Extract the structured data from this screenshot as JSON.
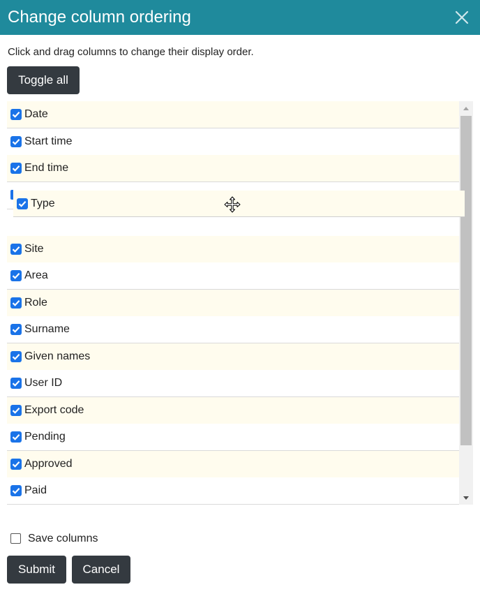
{
  "dialog": {
    "title": "Change column ordering",
    "close_icon": "close-icon",
    "instruction": "Click and drag columns to change their display order.",
    "toggle_all_label": "Toggle all",
    "columns": [
      {
        "label": "Date",
        "checked": true
      },
      {
        "label": "Start time",
        "checked": true
      },
      {
        "label": "End time",
        "checked": true
      },
      {
        "label": "Site",
        "checked": true
      },
      {
        "label": "Area",
        "checked": true
      },
      {
        "label": "Role",
        "checked": true
      },
      {
        "label": "Surname",
        "checked": true
      },
      {
        "label": "Given names",
        "checked": true
      },
      {
        "label": "User ID",
        "checked": true
      },
      {
        "label": "Export code",
        "checked": true
      },
      {
        "label": "Pending",
        "checked": true
      },
      {
        "label": "Approved",
        "checked": true
      },
      {
        "label": "Paid",
        "checked": true
      }
    ],
    "dragging": {
      "label": "Type",
      "checked": true,
      "cursor_icon": "move-cursor-icon"
    },
    "save_columns_label": "Save columns",
    "save_columns_checked": false,
    "submit_label": "Submit",
    "cancel_label": "Cancel"
  },
  "colors": {
    "header_bg": "#1f8a9c",
    "button_bg": "#343a40",
    "row_alt_bg": "#fffcee",
    "checkbox_blue": "#1a73e8"
  }
}
